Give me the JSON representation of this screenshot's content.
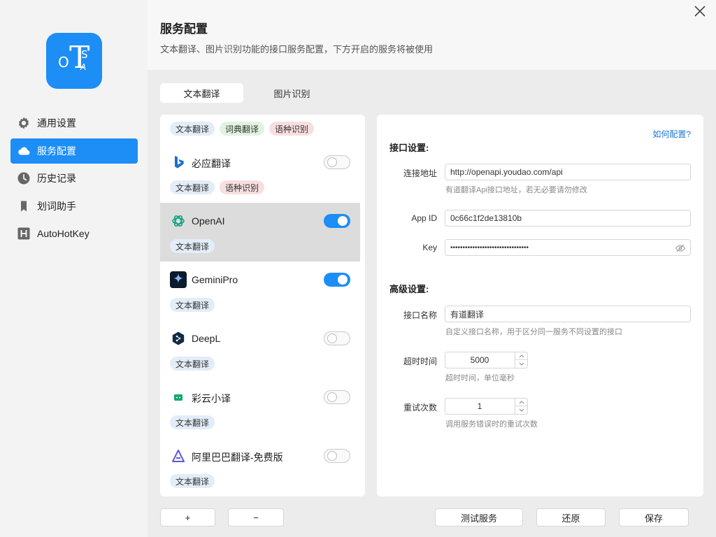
{
  "app": {
    "accent": "#1c8ef5"
  },
  "logo": {
    "o": "O",
    "t": "T",
    "s": "S",
    "a": "A"
  },
  "sidebar": {
    "items": [
      {
        "label": "通用设置",
        "icon": "gear-icon"
      },
      {
        "label": "服务配置",
        "icon": "cloud-icon",
        "active": true
      },
      {
        "label": "历史记录",
        "icon": "clock-icon"
      },
      {
        "label": "划词助手",
        "icon": "bookmark-icon"
      },
      {
        "label": "AutoHotKey",
        "icon": "autohotkey-icon"
      }
    ]
  },
  "header": {
    "title": "服务配置",
    "subtitle": "文本翻译、图片识别功能的接口服务配置，下方开启的服务将被使用"
  },
  "tabs": [
    {
      "label": "文本翻译",
      "active": true
    },
    {
      "label": "图片识别",
      "active": false
    }
  ],
  "services": [
    {
      "name": "",
      "tags": [
        "文本翻译",
        "词典翻译",
        "语种识别"
      ],
      "enabled": null
    },
    {
      "name": "必应翻译",
      "logo": "bing-icon",
      "tags": [
        "文本翻译",
        "语种识别"
      ],
      "enabled": false
    },
    {
      "name": "OpenAI",
      "logo": "openai-icon",
      "tags": [
        "文本翻译"
      ],
      "enabled": true,
      "selected": true
    },
    {
      "name": "GeminiPro",
      "logo": "gemini-icon",
      "tags": [
        "文本翻译"
      ],
      "enabled": true
    },
    {
      "name": "DeepL",
      "logo": "deepl-icon",
      "tags": [
        "文本翻译"
      ],
      "enabled": false
    },
    {
      "name": "彩云小译",
      "logo": "caiyun-icon",
      "tags": [
        "文本翻译"
      ],
      "enabled": false
    },
    {
      "name": "阿里巴巴翻译-免费版",
      "logo": "alibaba-icon",
      "tags": [
        "文本翻译"
      ],
      "enabled": false
    }
  ],
  "settings": {
    "howto": "如何配置?",
    "api_section": "接口设置:",
    "advanced_section": "高级设置:",
    "url": {
      "label": "连接地址",
      "value": "http://openapi.youdao.com/api",
      "hint": "有道翻译Api接口地址，若无必要请勿修改"
    },
    "appid": {
      "label": "App ID",
      "value": "0c66c1f2de13810b"
    },
    "key": {
      "label": "Key",
      "value": "••••••••••••••••••••••••••••••••"
    },
    "name": {
      "label": "接口名称",
      "value": "有道翻译",
      "hint": "自定义接口名称，用于区分同一服务不同设置的接口"
    },
    "timeout": {
      "label": "超时时间",
      "value": "5000",
      "hint": "超时时间，单位毫秒"
    },
    "retry": {
      "label": "重试次数",
      "value": "1",
      "hint": "调用服务错误时的重试次数"
    }
  },
  "footer": {
    "add": "+",
    "remove": "−",
    "test": "测试服务",
    "reset": "还原",
    "save": "保存"
  }
}
